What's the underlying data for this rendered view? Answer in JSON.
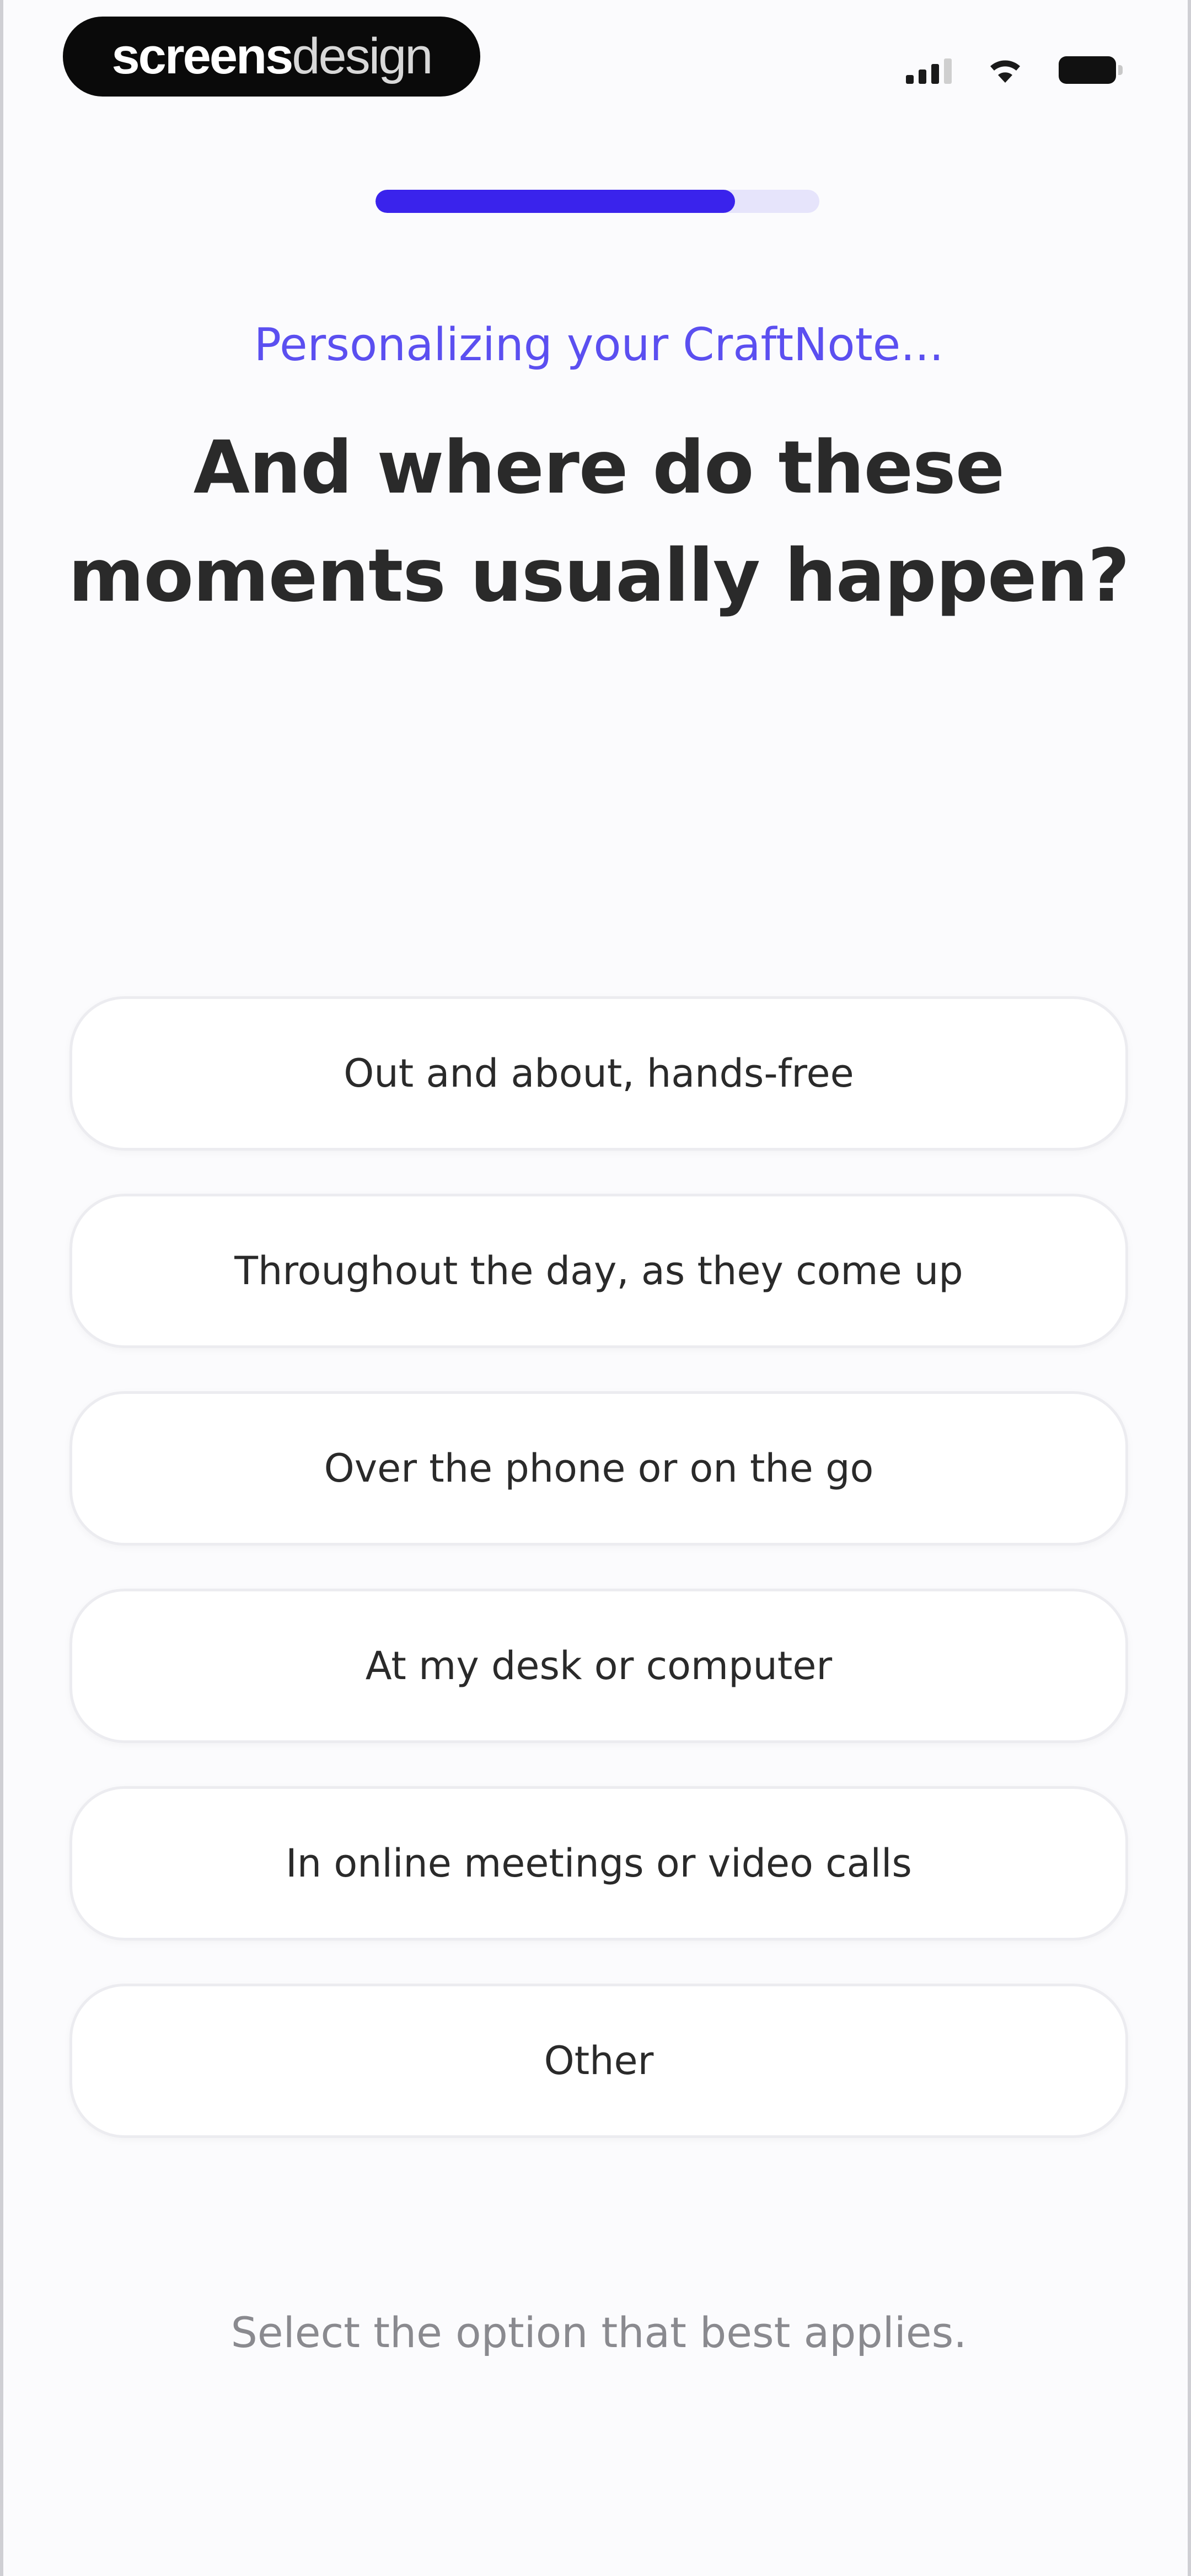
{
  "status_bar": {
    "badge_part1": "screens",
    "badge_part2": "design"
  },
  "progress": {
    "value": 0.81,
    "fill_color": "#3a23ec",
    "track_color": "#e6e4fb"
  },
  "header": {
    "subtitle": "Personalizing your CraftNote...",
    "title": "And where do these moments usually happen?"
  },
  "options": [
    {
      "label": "Out and about, hands-free"
    },
    {
      "label": "Throughout the day, as they come up"
    },
    {
      "label": "Over the phone or on the go"
    },
    {
      "label": "At my desk or computer"
    },
    {
      "label": "In online meetings or video calls"
    },
    {
      "label": "Other"
    }
  ],
  "footer": {
    "hint": "Select the option that best applies."
  },
  "colors": {
    "accent": "#5b4ff0",
    "text": "#2a2a2a",
    "muted": "#8a8a8f"
  },
  "icons": [
    "signal-icon",
    "wifi-icon",
    "battery-icon"
  ]
}
